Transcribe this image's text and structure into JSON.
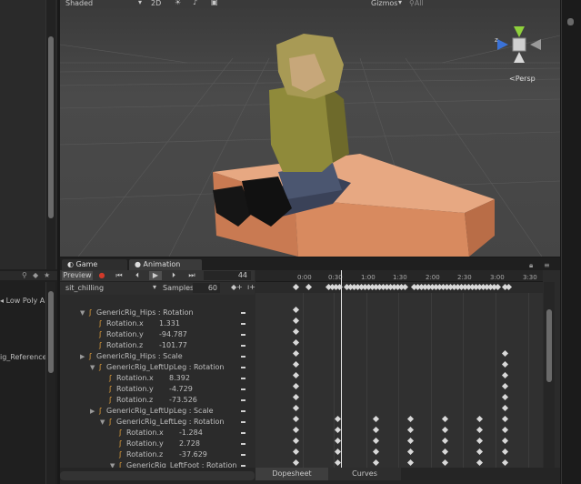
{
  "scene_toolbar": {
    "shading": "Shaded",
    "mode_2d": "2D",
    "gizmos": "Gizmos",
    "search_placeholder": "All"
  },
  "scene": {
    "persp_label": "Persp",
    "axis_z": "z"
  },
  "left_panel": {
    "items": [
      "Low Poly An",
      "ig_Reference"
    ]
  },
  "tabs": {
    "game": "Game",
    "animation": "Animation"
  },
  "anim_controls": {
    "preview": "Preview",
    "frame": "44",
    "clip": "sit_chilling",
    "samples_label": "Samples",
    "samples": "60"
  },
  "timeline": {
    "ticks": [
      "0:00",
      "0:30",
      "1:00",
      "1:30",
      "2:00",
      "2:30",
      "3:00",
      "3:30"
    ]
  },
  "properties": [
    {
      "label": "GenericRig_Hips : Rotation",
      "value": "",
      "kind": "group",
      "indent": 0
    },
    {
      "label": "Rotation.x",
      "value": "1.331",
      "kind": "prop",
      "indent": 1
    },
    {
      "label": "Rotation.y",
      "value": "-94.787",
      "kind": "prop",
      "indent": 1
    },
    {
      "label": "Rotation.z",
      "value": "-101.77",
      "kind": "prop",
      "indent": 1
    },
    {
      "label": "GenericRig_Hips : Scale",
      "value": "",
      "kind": "group-collapsed",
      "indent": 0
    },
    {
      "label": "GenericRig_LeftUpLeg : Rotation",
      "value": "",
      "kind": "group",
      "indent": 1
    },
    {
      "label": "Rotation.x",
      "value": "8.392",
      "kind": "prop",
      "indent": 2
    },
    {
      "label": "Rotation.y",
      "value": "-4.729",
      "kind": "prop",
      "indent": 2
    },
    {
      "label": "Rotation.z",
      "value": "-73.526",
      "kind": "prop",
      "indent": 2
    },
    {
      "label": "GenericRig_LeftUpLeg : Scale",
      "value": "",
      "kind": "group-collapsed",
      "indent": 1
    },
    {
      "label": "GenericRig_LeftLeg : Rotation",
      "value": "",
      "kind": "group",
      "indent": 2
    },
    {
      "label": "Rotation.x",
      "value": "-1.284",
      "kind": "prop",
      "indent": 3
    },
    {
      "label": "Rotation.y",
      "value": "2.728",
      "kind": "prop",
      "indent": 3
    },
    {
      "label": "Rotation.z",
      "value": "-37.629",
      "kind": "prop",
      "indent": 3
    },
    {
      "label": "GenericRig_LeftFoot : Rotation",
      "value": "",
      "kind": "group",
      "indent": 3
    }
  ],
  "bottom_tabs": {
    "dopesheet": "Dopesheet",
    "curves": "Curves"
  }
}
